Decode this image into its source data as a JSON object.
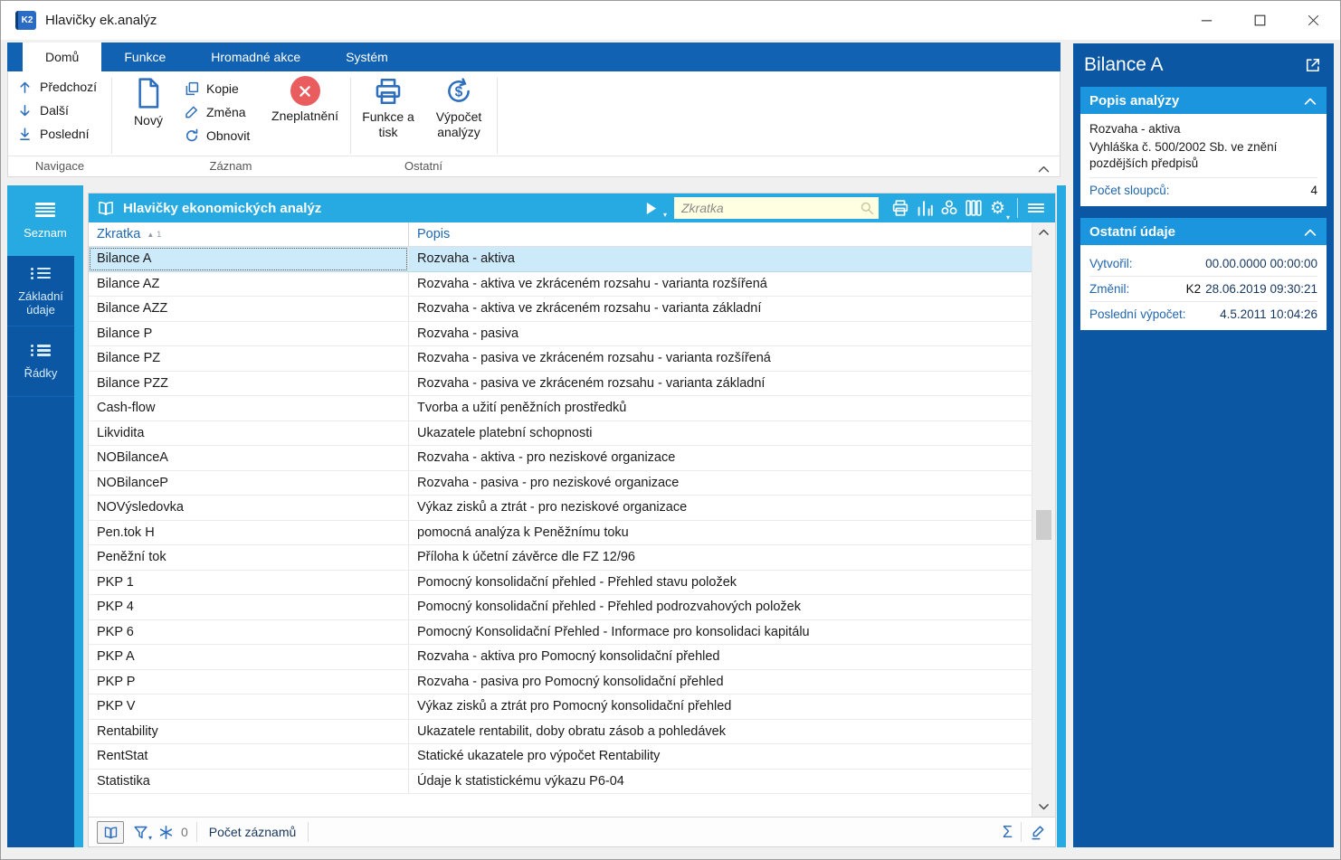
{
  "window": {
    "title": "Hlavičky ek.analýz",
    "app_badge": "K2"
  },
  "ribbon": {
    "tabs": [
      {
        "label": "Domů"
      },
      {
        "label": "Funkce"
      },
      {
        "label": "Hromadné akce"
      },
      {
        "label": "Systém"
      }
    ],
    "nav": {
      "prev": "Předchozí",
      "next": "Další",
      "last": "Poslední",
      "group": "Navigace"
    },
    "record": {
      "new": "Nový",
      "copy": "Kopie",
      "edit": "Změna",
      "refresh": "Obnovit",
      "invalidate": "Zneplatnění",
      "group": "Záznam"
    },
    "other": {
      "print": "Funkce a tisk",
      "calc": "Výpočet analýzy",
      "group": "Ostatní"
    }
  },
  "sidebar": {
    "items": [
      {
        "label": "Seznam",
        "active": true
      },
      {
        "label": "Základní údaje",
        "active": false
      },
      {
        "label": "Řádky",
        "active": false
      }
    ]
  },
  "table": {
    "title": "Hlavičky ekonomických analýz",
    "search_placeholder": "Zkratka",
    "columns": [
      {
        "label": "Zkratka",
        "sort": "asc",
        "sort_order": "1"
      },
      {
        "label": "Popis"
      }
    ],
    "rows": [
      {
        "zkratka": "Bilance A",
        "popis": "Rozvaha - aktiva",
        "selected": true
      },
      {
        "zkratka": "Bilance AZ",
        "popis": "Rozvaha - aktiva ve zkráceném rozsahu - varianta rozšířená"
      },
      {
        "zkratka": "Bilance AZZ",
        "popis": "Rozvaha - aktiva ve zkráceném rozsahu - varianta základní"
      },
      {
        "zkratka": "Bilance P",
        "popis": "Rozvaha - pasiva"
      },
      {
        "zkratka": "Bilance PZ",
        "popis": "Rozvaha - pasiva ve zkráceném rozsahu - varianta rozšířená"
      },
      {
        "zkratka": "Bilance PZZ",
        "popis": "Rozvaha - pasiva ve zkráceném rozsahu - varianta základní"
      },
      {
        "zkratka": "Cash-flow",
        "popis": "Tvorba a užití peněžních prostředků"
      },
      {
        "zkratka": "Likvidita",
        "popis": "Ukazatele platební schopnosti"
      },
      {
        "zkratka": "NOBilanceA",
        "popis": "Rozvaha - aktiva - pro neziskové organizace"
      },
      {
        "zkratka": "NOBilanceP",
        "popis": "Rozvaha - pasiva - pro neziskové organizace"
      },
      {
        "zkratka": "NOVýsledovka",
        "popis": "Výkaz zisků a ztrát - pro neziskové organizace"
      },
      {
        "zkratka": "Pen.tok H",
        "popis": "pomocná analýza k Peněžnímu toku"
      },
      {
        "zkratka": "Peněžní tok",
        "popis": "Příloha k účetní závěrce dle FZ 12/96"
      },
      {
        "zkratka": "PKP 1",
        "popis": "Pomocný konsolidační přehled - Přehled stavu položek"
      },
      {
        "zkratka": "PKP 4",
        "popis": "Pomocný konsolidační přehled - Přehled podrozvahových položek"
      },
      {
        "zkratka": "PKP 6",
        "popis": "Pomocný Konsolidační Přehled - Informace pro konsolidaci kapitálu"
      },
      {
        "zkratka": "PKP A",
        "popis": "Rozvaha - aktiva pro Pomocný konsolidační přehled"
      },
      {
        "zkratka": "PKP P",
        "popis": "Rozvaha - pasiva pro Pomocný konsolidační přehled"
      },
      {
        "zkratka": "PKP V",
        "popis": "Výkaz zisků a ztrát pro Pomocný konsolidační přehled"
      },
      {
        "zkratka": "Rentability",
        "popis": "Ukazatele rentabilit, doby obratu zásob a pohledávek"
      },
      {
        "zkratka": "RentStat",
        "popis": "Statické ukazatele pro výpočet Rentability"
      },
      {
        "zkratka": "Statistika",
        "popis": "Údaje k statistickému výkazu P6-04"
      }
    ]
  },
  "statusbar": {
    "frozen_count": "0",
    "records_label": "Počet záznamů"
  },
  "panel": {
    "title": "Bilance A",
    "sections": [
      {
        "title": "Popis analýzy",
        "lines": [
          "Rozvaha - aktiva",
          "Vyhláška č. 500/2002 Sb. ve znění pozdějších předpisů"
        ],
        "fields": [
          {
            "label": "Počet sloupců:",
            "value": "4"
          }
        ]
      },
      {
        "title": "Ostatní údaje",
        "fields": [
          {
            "label": "Vytvořil:",
            "value": "00.00.0000 00:00:00"
          },
          {
            "label": "Změnil:",
            "user": "K2",
            "value": "28.06.2019 09:30:21"
          },
          {
            "label": "Poslední výpočet:",
            "value": "4.5.2011 10:04:26"
          }
        ]
      }
    ]
  },
  "colors": {
    "accent_cyan": "#27aae1",
    "dark_blue": "#0b57a4",
    "tab_blue": "#1162b2",
    "selected_row": "#cdeafa",
    "invalid_red": "#ea5d5f",
    "search_bg": "#ffffe1",
    "label_blue": "#1f68b5",
    "value_navy": "#17375e"
  }
}
